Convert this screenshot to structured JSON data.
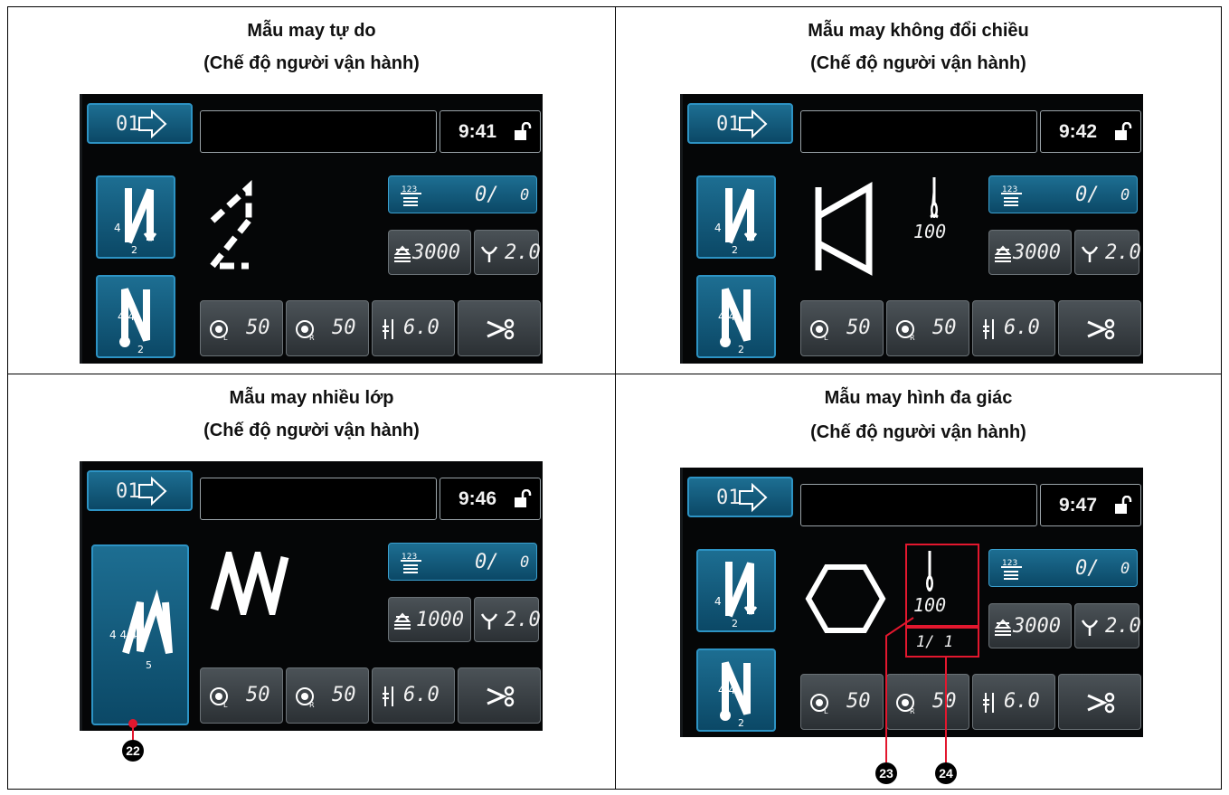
{
  "panels": [
    {
      "title1": "Mẫu may tự do",
      "title2": "(Chế độ người vận hành)",
      "prog": "01",
      "time": "9:41",
      "counter_val": "0/",
      "counter_total": "0",
      "speed": "3000",
      "pitch": "2.0",
      "tension_l": "50",
      "tension_r": "50",
      "height": "6.0"
    },
    {
      "title1": "Mẫu may không đổi chiều",
      "title2": "(Chế độ người vận hành)",
      "prog": "01",
      "time": "9:42",
      "counter_val": "0/",
      "counter_total": "0",
      "speed": "3000",
      "pitch": "2.0",
      "tension_l": "50",
      "tension_r": "50",
      "height": "6.0",
      "stitch_count": "100"
    },
    {
      "title1": "Mẫu may nhiều lớp",
      "title2": "(Chế độ người vận hành)",
      "prog": "01",
      "time": "9:46",
      "counter_val": "0/",
      "counter_total": "0",
      "speed": "1000",
      "pitch": "2.0",
      "tension_l": "50",
      "tension_r": "50",
      "height": "6.0"
    },
    {
      "title1": "Mẫu may hình đa giác",
      "title2": "(Chế độ người vận hành)",
      "prog": "01",
      "time": "9:47",
      "counter_val": "0/",
      "counter_total": "0",
      "speed": "3000",
      "pitch": "2.0",
      "tension_l": "50",
      "tension_r": "50",
      "height": "6.0",
      "stitch_count": "100",
      "step": "1/ 1"
    }
  ],
  "callouts": {
    "c22": "22",
    "c23": "23",
    "c24": "24"
  },
  "colors": {
    "accent_blue": "#1d6e92",
    "callout_red": "#e3172e",
    "screen_bg": "#050607"
  }
}
